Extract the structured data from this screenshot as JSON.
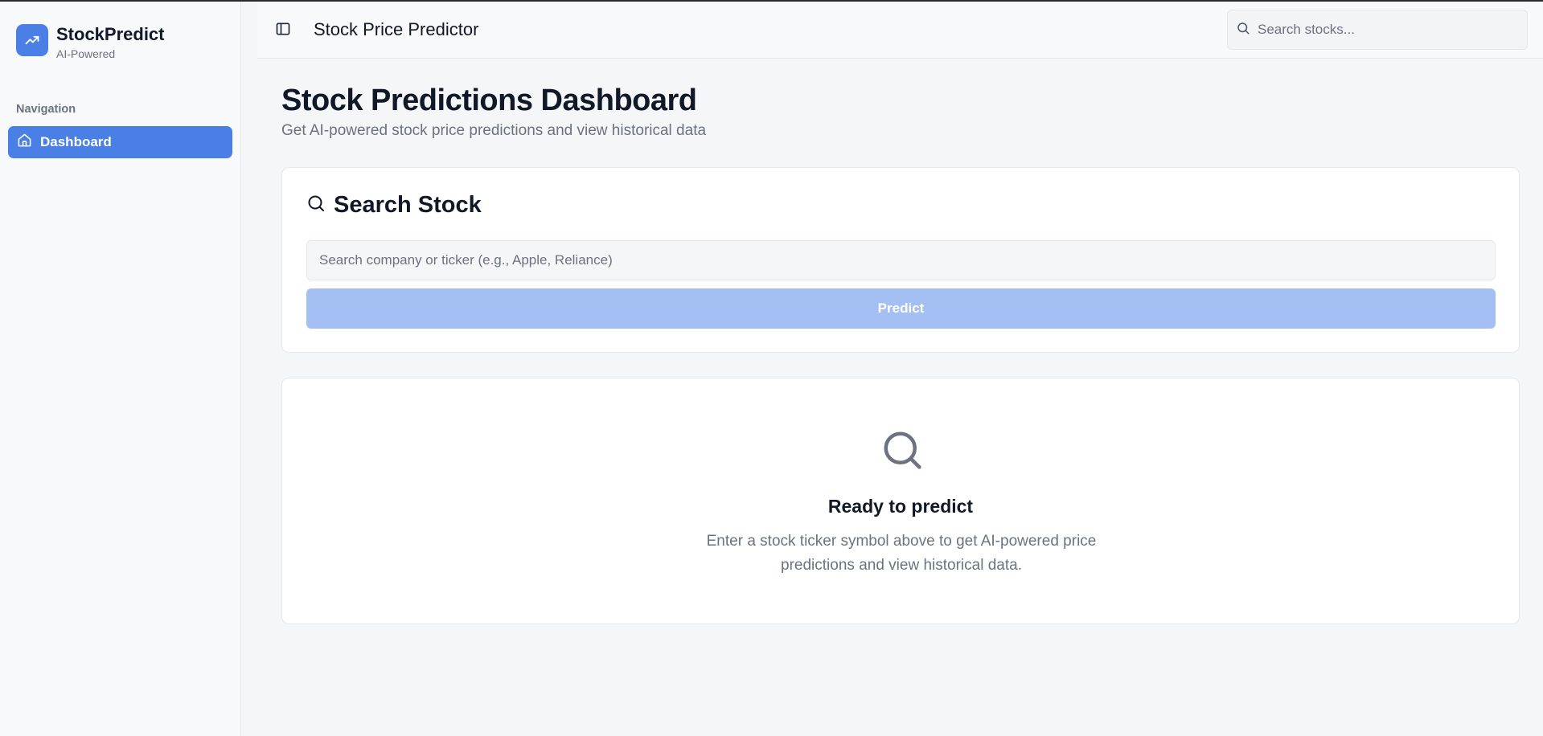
{
  "brand": {
    "name": "StockPredict",
    "subtitle": "AI-Powered",
    "accent": "#4a7fe6"
  },
  "sidebar": {
    "section_label": "Navigation",
    "items": [
      {
        "label": "Dashboard",
        "icon": "home-icon",
        "active": true
      }
    ]
  },
  "header": {
    "title": "Stock Price Predictor",
    "search_placeholder": "Search stocks..."
  },
  "main": {
    "title": "Stock Predictions Dashboard",
    "subtitle": "Get AI-powered stock price predictions and view historical data",
    "search_card": {
      "heading": "Search Stock",
      "input_placeholder": "Search company or ticker (e.g., Apple, Reliance)",
      "input_value": "",
      "button_label": "Predict",
      "button_disabled": true
    },
    "empty_state": {
      "title": "Ready to predict",
      "description": "Enter a stock ticker symbol above to get AI-powered price predictions and view historical data."
    }
  }
}
